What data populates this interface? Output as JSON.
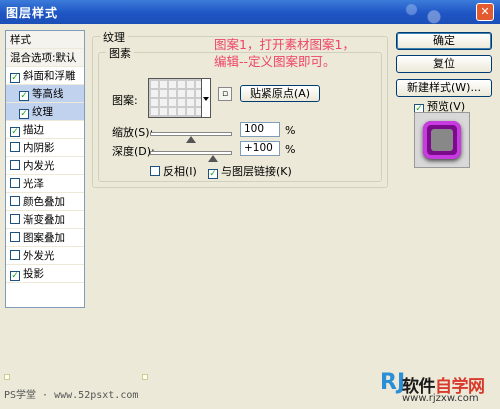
{
  "window": {
    "title": "图层样式",
    "close_glyph": "✕"
  },
  "left_panel": {
    "header": "样式",
    "blend": "混合选项:默认",
    "items": [
      {
        "label": "斜面和浮雕",
        "checked": true
      },
      {
        "label": "等高线",
        "checked": true
      },
      {
        "label": "纹理",
        "checked": true
      },
      {
        "label": "描边",
        "checked": true
      },
      {
        "label": "内阴影",
        "checked": false
      },
      {
        "label": "内发光",
        "checked": false
      },
      {
        "label": "光泽",
        "checked": false
      },
      {
        "label": "颜色叠加",
        "checked": false
      },
      {
        "label": "渐变叠加",
        "checked": false
      },
      {
        "label": "图案叠加",
        "checked": false
      },
      {
        "label": "外发光",
        "checked": false
      },
      {
        "label": "投影",
        "checked": true
      }
    ],
    "check_glyph": "✓"
  },
  "texture": {
    "group_title": "纹理",
    "sub_title": "图素",
    "pattern_label": "图案:",
    "snap_button": "贴紧原点(A)",
    "scale_label": "缩放(S):",
    "scale_value": "100",
    "scale_unit": "%",
    "depth_label": "深度(D):",
    "depth_value": "+100",
    "depth_unit": "%",
    "invert_label": "反相(I)",
    "invert_checked": false,
    "link_label": "与图层链接(K)",
    "link_checked": true
  },
  "annotation": {
    "line1": "图案1，打开素材图案1，",
    "line2": "编辑--定义图案即可。"
  },
  "right": {
    "ok": "确定",
    "reset": "复位",
    "new_style": "新建样式(W)...",
    "preview_label": "预览(V)",
    "preview_checked": true
  },
  "footer": {
    "left_text": "PS学堂 · www.52psxt.com",
    "wm_logo": "RJ",
    "wm_name_a": "软件",
    "wm_name_b": "自学网",
    "wm_url": "www.rjzxw.com"
  }
}
